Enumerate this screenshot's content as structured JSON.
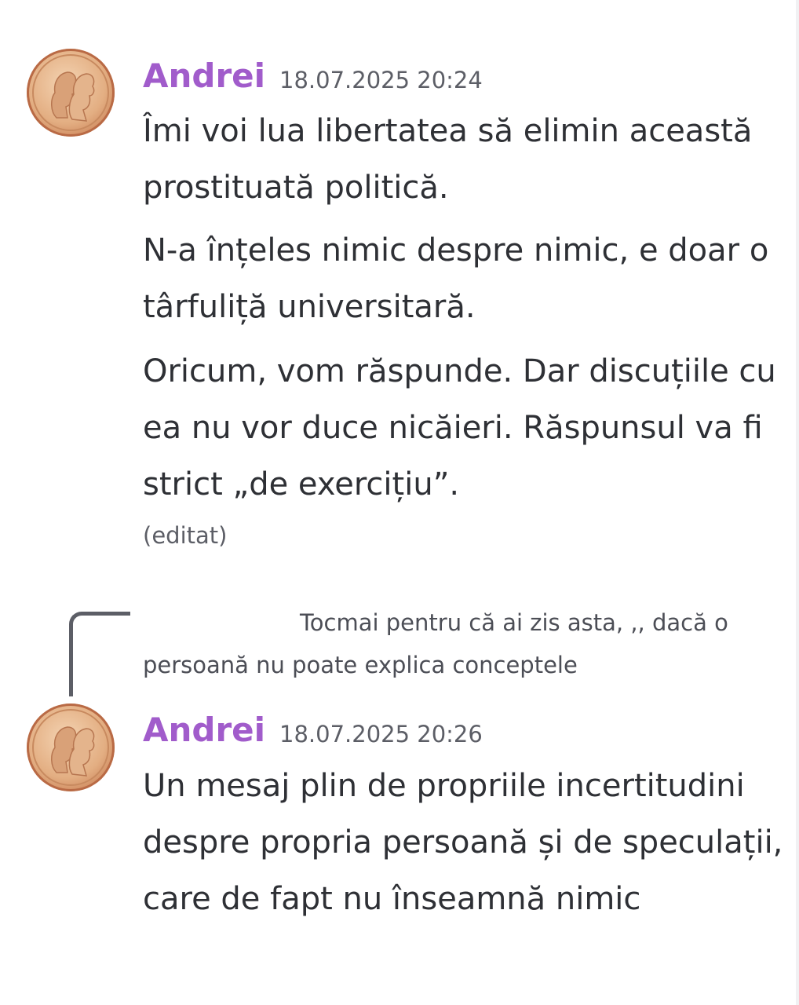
{
  "messages": [
    {
      "author": "Andrei",
      "timestamp": "18.07.2025 20:24",
      "paragraphs": [
        "Îmi voi lua libertatea să elimin această prostituată politică.",
        "N-a înțeles nimic despre nimic, e doar o târfuliță universitară.",
        "Oricum, vom răspunde. Dar discuțiile cu ea nu vor duce nicăieri. Răspunsul va fi strict „de exercițiu”."
      ],
      "edited": "(editat)"
    },
    {
      "reply_preview": "Tocmai pentru că ai zis asta, ,, dacă o persoană nu poate explica conceptele",
      "author": "Andrei",
      "timestamp": "18.07.2025 20:26",
      "paragraphs": [
        "Un mesaj plin de propriile incertitudini despre propria persoană și de speculații, care de fapt nu înseamnă nimic"
      ]
    }
  ],
  "colors": {
    "author": "#a15ccb",
    "text": "#2e3035",
    "muted": "#5c5e66",
    "background": "#ffffff"
  },
  "icons": {
    "avatar": "medal-portrait-avatar",
    "reply_connector": "reply-spine-icon"
  }
}
